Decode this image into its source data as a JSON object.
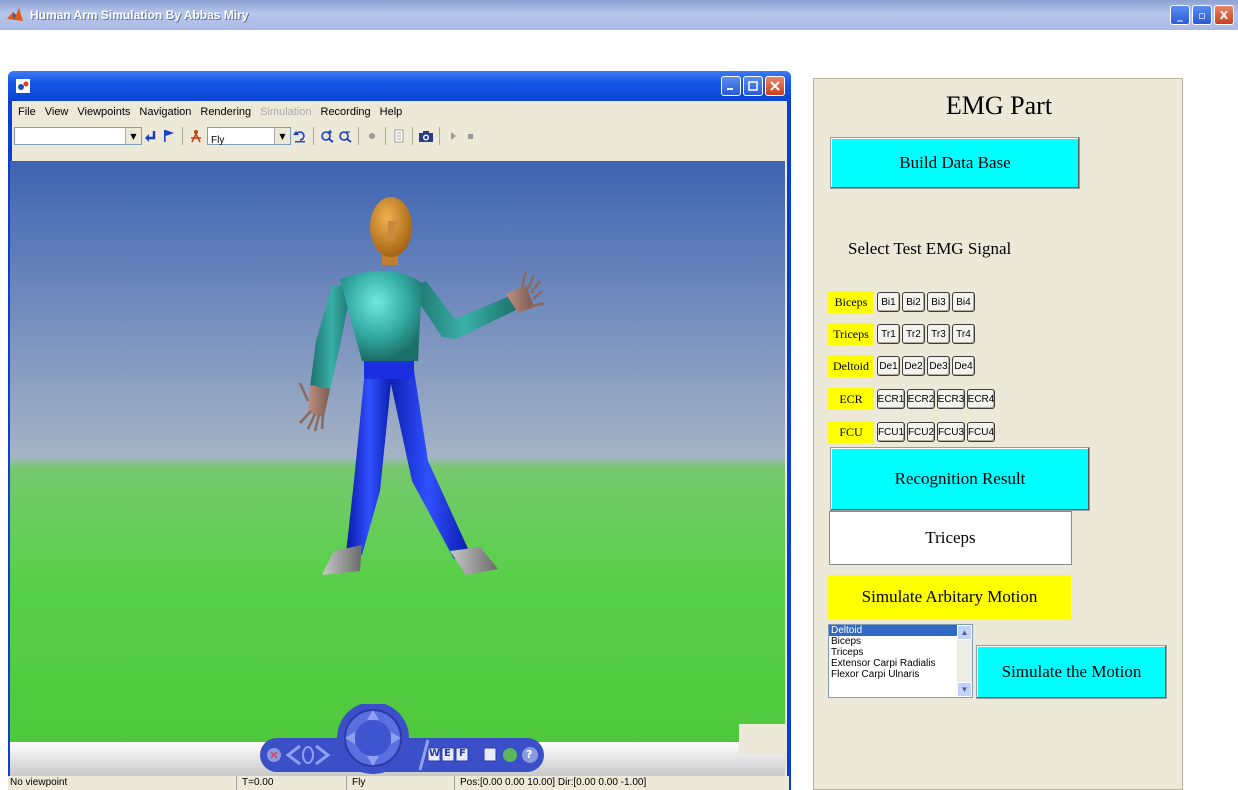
{
  "window": {
    "title": "Human Arm Simulation By Abbas Miry",
    "min": "_",
    "max": "▫",
    "close": "X"
  },
  "viewer": {
    "menu": [
      "File",
      "View",
      "Viewpoints",
      "Navigation",
      "Rendering",
      "Simulation",
      "Recording",
      "Help"
    ],
    "disabled_menu": "Simulation",
    "toolbar": {
      "viewpoint_value": "",
      "nav_mode_value": "Fly"
    },
    "nav_letters": {
      "w": "W",
      "e": "E",
      "f": "F",
      "help": "?"
    },
    "status": {
      "viewpoint": "No viewpoint",
      "time": "T=0.00",
      "mode": "Fly",
      "pos": "Pos:[0.00 0.00 10.00] Dir:[0.00 0.00 -1.00]"
    }
  },
  "emg": {
    "title": "EMG Part",
    "build_db": "Build  Data Base",
    "select_label": "Select Test EMG Signal",
    "muscles": [
      {
        "name": "Biceps",
        "buttons": [
          "Bi1",
          "Bi2",
          "Bi3",
          "Bi4"
        ]
      },
      {
        "name": "Triceps",
        "buttons": [
          "Tr1",
          "Tr2",
          "Tr3",
          "Tr4"
        ]
      },
      {
        "name": "Deltoid",
        "buttons": [
          "De1",
          "De2",
          "De3",
          "De4"
        ]
      },
      {
        "name": "ECR",
        "buttons": [
          "ECR1",
          "ECR2",
          "ECR3",
          "ECR4"
        ]
      },
      {
        "name": "FCU",
        "buttons": [
          "FCU1",
          "FCU2",
          "FCU3",
          "FCU4"
        ]
      }
    ],
    "recognition_button": "Recognition Result",
    "result": "Triceps",
    "simulate_arbitrary": "Simulate Arbitary Motion",
    "list_items": [
      "Deltoid",
      "Biceps",
      "Triceps",
      "Extensor Carpi Radialis",
      "Flexor Carpi Ulnaris"
    ],
    "list_selected": "Deltoid",
    "simulate_button": "Simulate the Motion"
  },
  "colors": {
    "cyan_button": "#00ffff",
    "yellow_label": "#ffff00",
    "xp_blue": "#0a44d2"
  }
}
